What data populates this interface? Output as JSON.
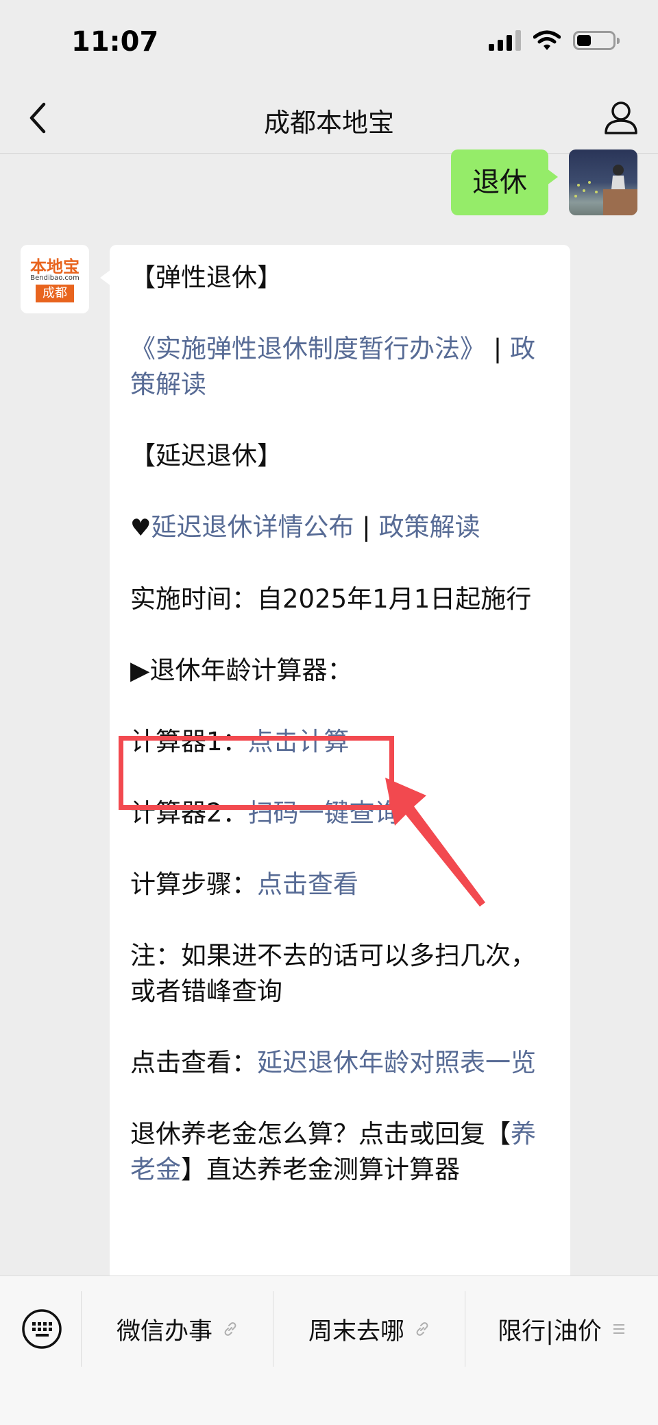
{
  "status_bar": {
    "time": "11:07"
  },
  "nav": {
    "title": "成都本地宝"
  },
  "outgoing_message": {
    "text": "退休"
  },
  "bot": {
    "logo_top": "本地宝",
    "logo_mid": "Bendibao.com",
    "logo_bottom": "成都"
  },
  "message": {
    "flex_heading": "【弹性退休】",
    "flex_link": "《实施弹性退休制度暂行办法》",
    "sep": "|",
    "flex_policy": "政策解读",
    "delay_heading": "【延迟退休】",
    "heart": "♥",
    "delay_link": "延迟退休详情公布",
    "delay_policy": "政策解读",
    "impl_time": "实施时间：自2025年1月1日起施行",
    "calc_heading": "▶退休年龄计算器：",
    "calc1_label": "计算器1：",
    "calc1_link": "点击计算",
    "calc2_label": "计算器2：",
    "calc2_link": "扫码一键查询",
    "steps_label": "计算步骤：",
    "steps_link": "点击查看",
    "note": "注：如果进不去的话可以多扫几次，或者错峰查询",
    "view_label": "点击查看：",
    "view_link": "延迟退休年龄对照表一览",
    "pension_pre": "退休养老金怎么算？点击或回复【",
    "pension_link": "养老金",
    "pension_post": "】直达养老金测算计算器"
  },
  "bottom_menu": [
    {
      "label": "微信办事",
      "icon": "link-icon"
    },
    {
      "label": "周末去哪",
      "icon": "link-icon"
    },
    {
      "label": "限行|油价",
      "icon": "menu-list-icon"
    }
  ],
  "colors": {
    "link": "#576b95",
    "my_bubble": "#95ec69",
    "highlight": "#f2494f",
    "brand_orange": "#e8641e"
  }
}
